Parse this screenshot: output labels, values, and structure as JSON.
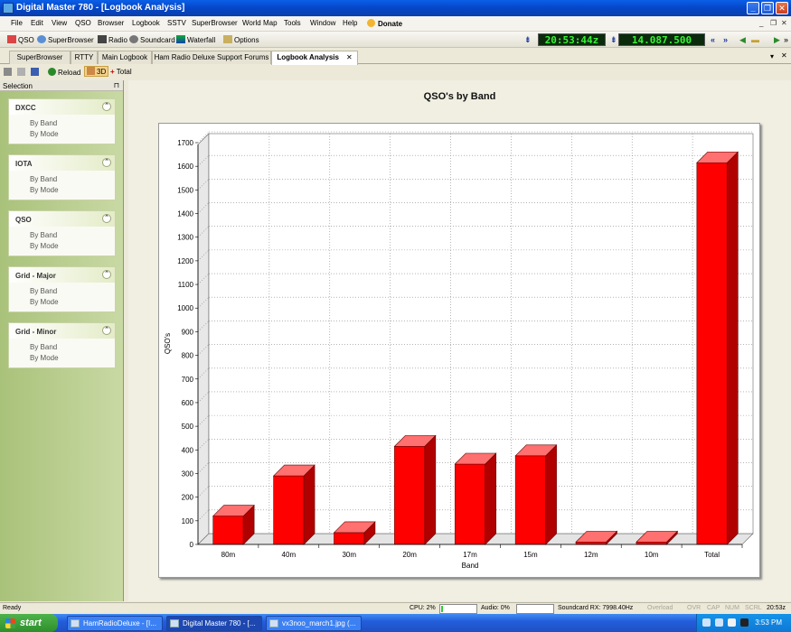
{
  "window": {
    "title": "Digital Master 780 - [Logbook Analysis]"
  },
  "menu": {
    "items": [
      "File",
      "Edit",
      "View",
      "QSO",
      "Browser",
      "Logbook",
      "SSTV",
      "SuperBrowser",
      "World Map",
      "Tools",
      "Window",
      "Help"
    ],
    "donate": "Donate"
  },
  "toolbar": {
    "qso": "QSO",
    "superbrowser": "SuperBrowser",
    "radio": "Radio",
    "soundcard": "Soundcard",
    "waterfall": "Waterfall",
    "options": "Options",
    "time": "20:53:44z",
    "frequency": "14.087.500"
  },
  "tabs": [
    "SuperBrowser",
    "RTTY",
    "Main Logbook",
    "Ham Radio Deluxe Support Forums",
    "Logbook Analysis"
  ],
  "subtoolbar": {
    "reload": "Reload",
    "three_d": "3D",
    "total": "Total"
  },
  "sidebar": {
    "header": "Selection",
    "groups": [
      {
        "title": "DXCC",
        "links": [
          "By Band",
          "By Mode"
        ]
      },
      {
        "title": "IOTA",
        "links": [
          "By Band",
          "By Mode"
        ]
      },
      {
        "title": "QSO",
        "links": [
          "By Band",
          "By Mode"
        ]
      },
      {
        "title": "Grid - Major",
        "links": [
          "By Band",
          "By Mode"
        ]
      },
      {
        "title": "Grid - Minor",
        "links": [
          "By Band",
          "By Mode"
        ]
      }
    ]
  },
  "chart_data": {
    "type": "bar",
    "title": "QSO's by Band",
    "xlabel": "Band",
    "ylabel": "QSO's",
    "categories": [
      "80m",
      "40m",
      "30m",
      "20m",
      "17m",
      "15m",
      "12m",
      "10m",
      "Total"
    ],
    "values": [
      120,
      290,
      50,
      415,
      340,
      375,
      10,
      10,
      1615
    ],
    "ylim": [
      0,
      1700
    ],
    "yticks": [
      0,
      100,
      200,
      300,
      400,
      500,
      600,
      700,
      800,
      900,
      1000,
      1100,
      1200,
      1300,
      1400,
      1500,
      1600,
      1700
    ],
    "grid": true,
    "three_d": true,
    "bar_color": "#FF0000"
  },
  "status": {
    "ready": "Ready",
    "cpu": "CPU: 2%",
    "audio": "Audio: 0%",
    "soundcard_rx": "Soundcard RX: 7998.40Hz",
    "overload": "Overload",
    "ovr": "OVR",
    "cap": "CAP",
    "num": "NUM",
    "scrl": "SCRL",
    "time": "20:53z"
  },
  "taskbar": {
    "start": "start",
    "tasks": [
      "HamRadioDeluxe - [I...",
      "Digital Master 780 - [...",
      "vx3noo_march1.jpg (..."
    ],
    "clock": "3:53 PM"
  }
}
